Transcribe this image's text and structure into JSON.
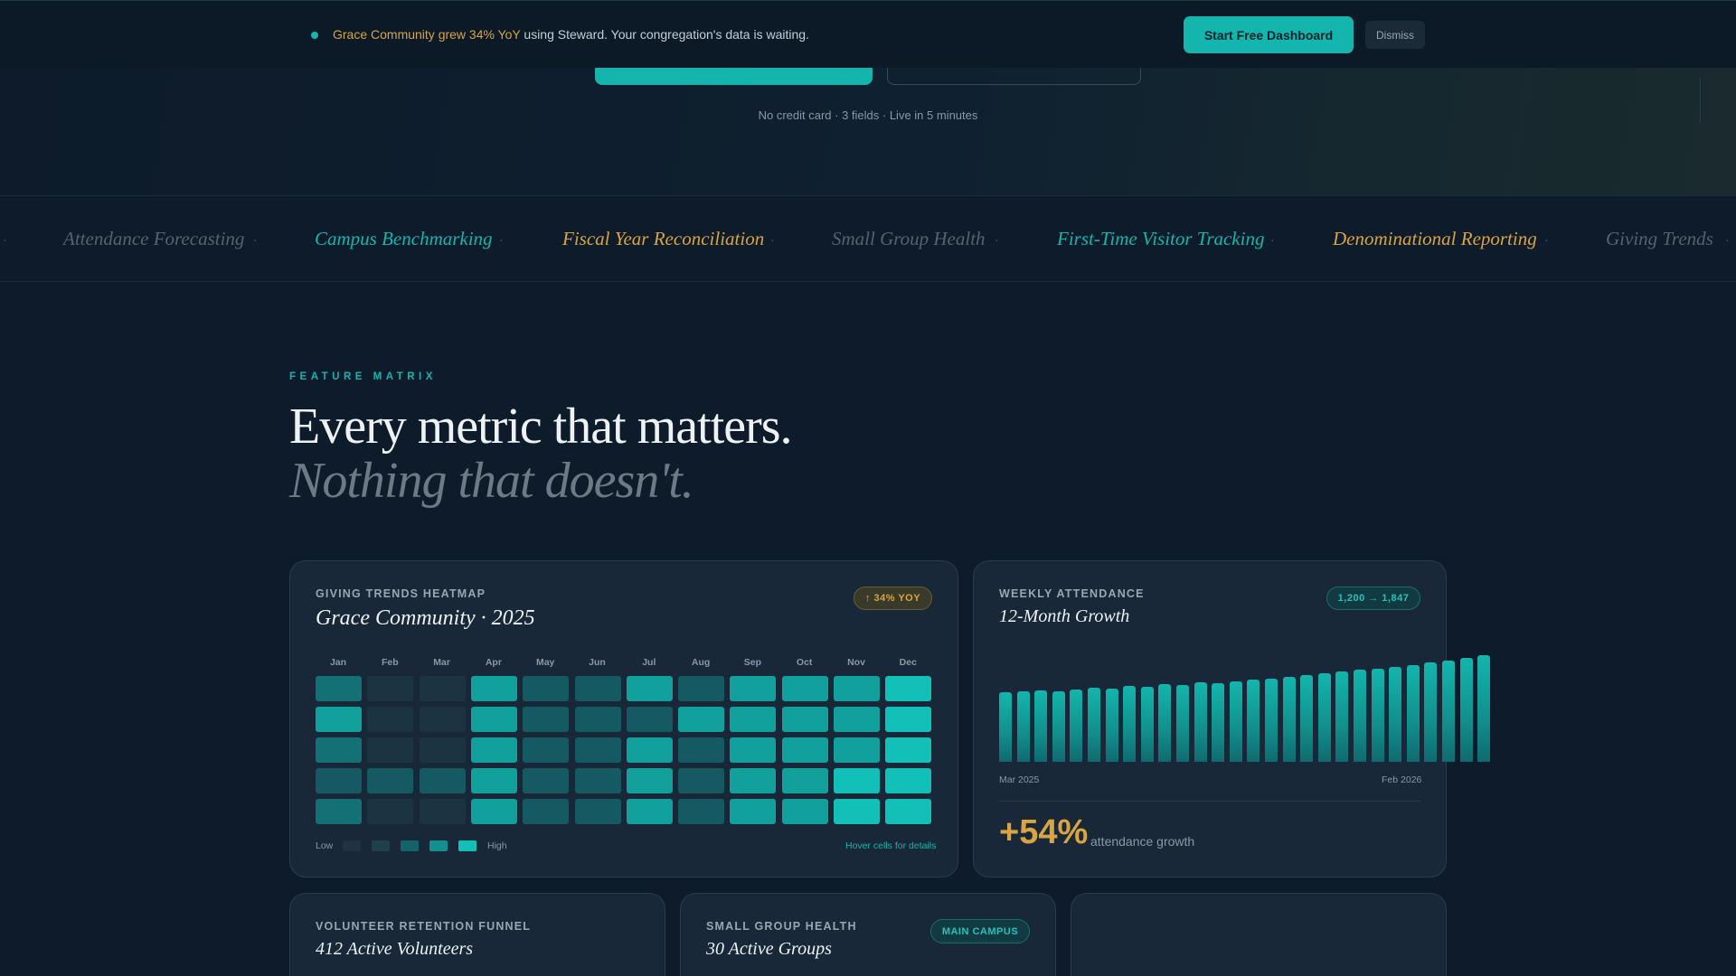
{
  "announcement": {
    "highlight": "Grace Community grew 34% YoY",
    "rest": " using Steward. Your congregation's data is waiting.",
    "cta_label": "Start Free Dashboard",
    "dismiss_label": "Dismiss"
  },
  "hero": {
    "note": "No credit card · 3 fields · Live in 5 minutes"
  },
  "marquee": [
    {
      "label": "Attendance Forecasting",
      "tone": "muted"
    },
    {
      "label": "Campus Benchmarking",
      "tone": "teal"
    },
    {
      "label": "Fiscal Year Reconciliation",
      "tone": "gold"
    },
    {
      "label": "Small Group Health",
      "tone": "muted"
    },
    {
      "label": "First-Time Visitor Tracking",
      "tone": "teal"
    },
    {
      "label": "Denominational Reporting",
      "tone": "gold"
    },
    {
      "label": "Giving Trends",
      "tone": "muted"
    }
  ],
  "section": {
    "eyebrow": "FEATURE MATRIX",
    "headline": "Every metric that matters.",
    "subheadline": "Nothing that doesn't."
  },
  "heatmap_card": {
    "label": "GIVING TRENDS HEATMAP",
    "title": "Grace Community · 2025",
    "badge": "↑ 34% YOY",
    "months": [
      "Jan",
      "Feb",
      "Mar",
      "Apr",
      "May",
      "Jun",
      "Jul",
      "Aug",
      "Sep",
      "Oct",
      "Nov",
      "Dec"
    ],
    "levels": [
      [
        3,
        1,
        1,
        4,
        2,
        2,
        4,
        2,
        4,
        4,
        4,
        5
      ],
      [
        4,
        1,
        1,
        4,
        2,
        2,
        2,
        4,
        4,
        4,
        4,
        5
      ],
      [
        3,
        1,
        1,
        4,
        2,
        2,
        4,
        2,
        4,
        4,
        4,
        5
      ],
      [
        2,
        2,
        2,
        4,
        2,
        2,
        4,
        2,
        4,
        4,
        5,
        5
      ],
      [
        3,
        1,
        1,
        4,
        2,
        2,
        4,
        2,
        4,
        4,
        5,
        5
      ]
    ],
    "legend_low": "Low",
    "legend_high": "High",
    "hover_hint": "Hover cells for details"
  },
  "attendance_card": {
    "label": "WEEKLY ATTENDANCE",
    "title": "12-Month Growth",
    "badge": "1,200 → 1,847",
    "axis_start": "Mar 2025",
    "axis_end": "Feb 2026",
    "growth_value": "+54%",
    "growth_label": "attendance growth"
  },
  "chart_data": {
    "type": "bar",
    "title": "12-Month Growth",
    "x_range": [
      "Mar 2025",
      "Feb 2026"
    ],
    "values": [
      1200,
      1215,
      1235,
      1225,
      1255,
      1290,
      1270,
      1310,
      1300,
      1345,
      1335,
      1370,
      1355,
      1400,
      1425,
      1445,
      1470,
      1510,
      1540,
      1570,
      1590,
      1620,
      1640,
      1680,
      1720,
      1760,
      1800,
      1847
    ],
    "ylim": [
      0,
      1847
    ]
  },
  "bottom_cards": [
    {
      "label": "VOLUNTEER RETENTION FUNNEL",
      "title": "412 Active Volunteers"
    },
    {
      "label": "SMALL GROUP HEALTH",
      "title": "30 Active Groups",
      "badge": "MAIN CAMPUS"
    }
  ],
  "colors": {
    "accent": "#13b5ad",
    "gold": "#d9a441",
    "background": "#0d1b2a",
    "card": "#182838"
  }
}
